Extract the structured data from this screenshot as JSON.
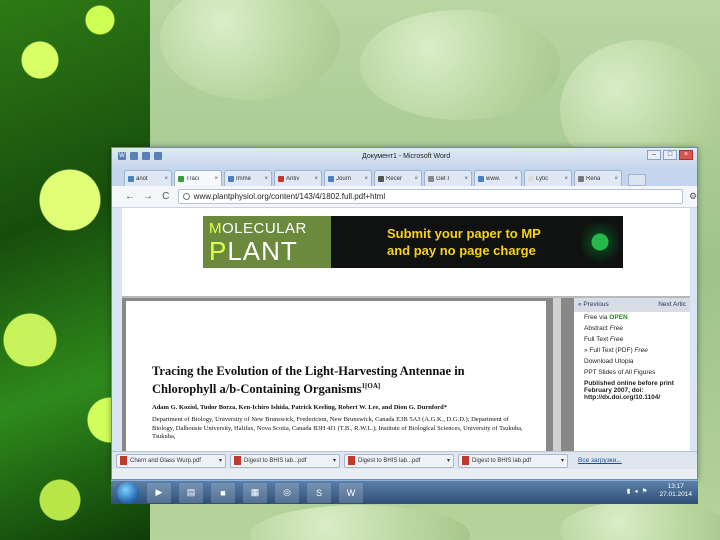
{
  "window": {
    "title": "Документ1 - Microsoft Word"
  },
  "tabs": [
    {
      "label": "anot",
      "active": false
    },
    {
      "label": "Traci",
      "active": true
    },
    {
      "label": "Imme",
      "active": false
    },
    {
      "label": "Antiv",
      "active": false
    },
    {
      "label": "Journ",
      "active": false
    },
    {
      "label": "Recer",
      "active": false
    },
    {
      "label": "Get I",
      "active": false
    },
    {
      "label": "www.",
      "active": false
    },
    {
      "label": "Lytic",
      "active": false
    },
    {
      "label": "Rena",
      "active": false
    }
  ],
  "address_bar": {
    "url": "www.plantphysiol.org/content/143/4/1802.full.pdf+html"
  },
  "banner": {
    "logo_line1_first": "M",
    "logo_line1_rest": "OLECULAR",
    "logo_line2_first": "P",
    "logo_line2_rest": "LANT",
    "ad_line1": "Submit your paper to MP",
    "ad_line2": "and pay no page charge"
  },
  "pdf": {
    "title": "Tracing the Evolution of the Light-Harvesting Antennae in Chlorophyll a/b-Containing Organisms",
    "title_mark": "1[OA]",
    "authors": "Adam G. Koziol, Tudor Borza, Ken-Ichiro Ishida, Patrick Keeling, Robert W. Lee, and Dion G. Durnford*",
    "affiliation": "Department of Biology, University of New Brunswick, Fredericton, New Brunswick, Canada E3B 5A3 (A.G.K., D.G.D.); Department of Biology, Dalhousie University, Halifax, Nova Scotia, Canada B3H 4J1 (T.B., R.W.L.); Institute of Biological Sciences, University of Tsukuba, Tsukuba,"
  },
  "side_panel": {
    "prev": "« Previous",
    "next": "Next Artic",
    "items": [
      {
        "text": "Free via ",
        "tag": "OPEN"
      },
      {
        "text": "Abstract ",
        "tag": "Free"
      },
      {
        "text": "Full Text ",
        "tag": "Free"
      },
      {
        "text": "» Full Text (PDF) ",
        "tag": "Free"
      },
      {
        "text": "Download Utopia",
        "tag": ""
      },
      {
        "text": "PPT Slides of All Figures",
        "tag": ""
      },
      {
        "text": "Published online before print February 2007, doi: http://dx.doi.org/10.1104/",
        "tag": ""
      }
    ]
  },
  "downloads": [
    {
      "label": "Chern and Glass Wurp.pdf"
    },
    {
      "label": "Digest to BHIS lab...pdf"
    },
    {
      "label": "Digest to BHIS lab...pdf"
    },
    {
      "label": "Digest to BHIS lab.pdf"
    }
  ],
  "downloads_show_all": "Все загрузки...",
  "taskbar": {
    "time": "13:17",
    "date": "27.01.2014"
  }
}
